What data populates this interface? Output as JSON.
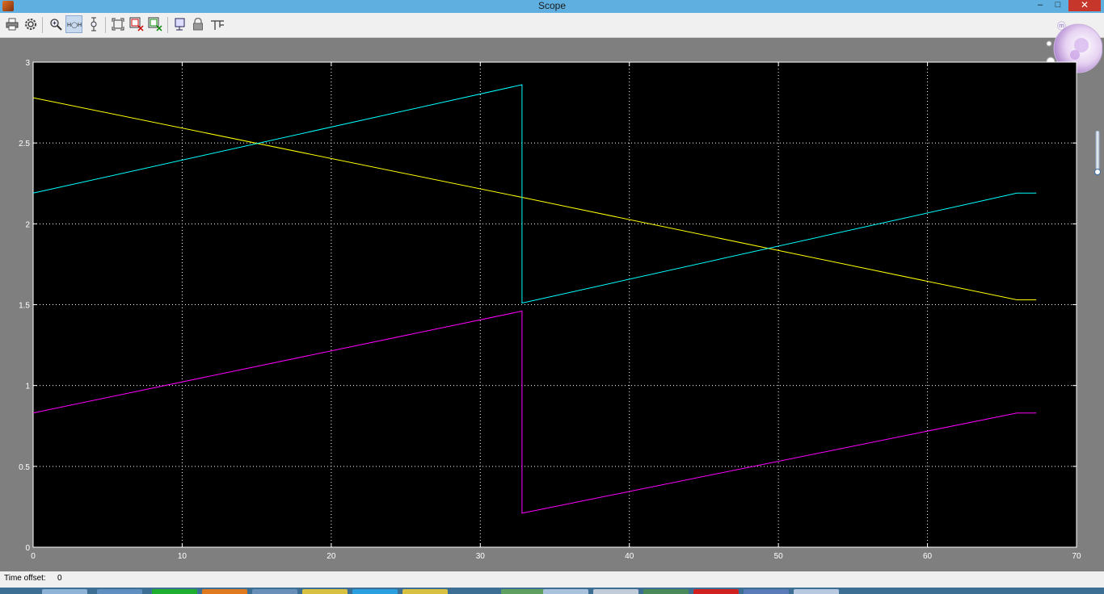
{
  "window": {
    "title": "Scope",
    "minimize_glyph": "–",
    "maximize_glyph": "□",
    "close_glyph": "✕"
  },
  "toolbar": {
    "buttons": [
      {
        "name": "print-icon",
        "tooltip": "Print"
      },
      {
        "name": "gear-icon",
        "tooltip": "Parameters"
      },
      {
        "name": "zoom-in-icon",
        "tooltip": "Zoom"
      },
      {
        "name": "zoom-x-icon",
        "tooltip": "Zoom X-axis",
        "active": true
      },
      {
        "name": "zoom-y-icon",
        "tooltip": "Zoom Y-axis"
      },
      {
        "name": "autoscale-icon",
        "tooltip": "Autoscale"
      },
      {
        "name": "save-axes-icon",
        "tooltip": "Save current axes settings"
      },
      {
        "name": "restore-axes-icon",
        "tooltip": "Restore saved axes settings"
      },
      {
        "name": "floating-scope-icon",
        "tooltip": "Floating scope"
      },
      {
        "name": "lock-icon",
        "tooltip": "Lock/Unlock axes selection"
      },
      {
        "name": "signal-selector-icon",
        "tooltip": "Signal selection"
      }
    ]
  },
  "status": {
    "time_offset_label": "Time offset:",
    "time_offset_value": "0"
  },
  "colors": {
    "plot_background": "#000000",
    "grid": "#ffffff",
    "series_yellow": "#ffff00",
    "series_cyan": "#00ffff",
    "series_magenta": "#ff00ff",
    "figure_background": "#7f7f7f"
  },
  "chart_data": {
    "type": "line",
    "title": "",
    "xlabel": "",
    "ylabel": "",
    "xlim": [
      0,
      70
    ],
    "ylim": [
      0,
      3
    ],
    "xticks": [
      "0",
      "10",
      "20",
      "30",
      "40",
      "50",
      "60",
      "70"
    ],
    "yticks": [
      "0",
      "0.5",
      "1",
      "1.5",
      "2",
      "2.5",
      "3"
    ],
    "grid": true,
    "series": [
      {
        "color": "yellow",
        "x": [
          0,
          33,
          66,
          67.3
        ],
        "y": [
          2.78,
          2.16,
          1.53,
          1.53
        ]
      },
      {
        "color": "cyan",
        "x": [
          0,
          32.8,
          32.8,
          66,
          67.3
        ],
        "y": [
          2.19,
          2.86,
          1.51,
          2.19,
          2.19
        ]
      },
      {
        "color": "magenta",
        "x": [
          0,
          32.8,
          32.8,
          66,
          67.3
        ],
        "y": [
          0.83,
          1.46,
          0.21,
          0.83,
          0.83
        ]
      }
    ]
  }
}
